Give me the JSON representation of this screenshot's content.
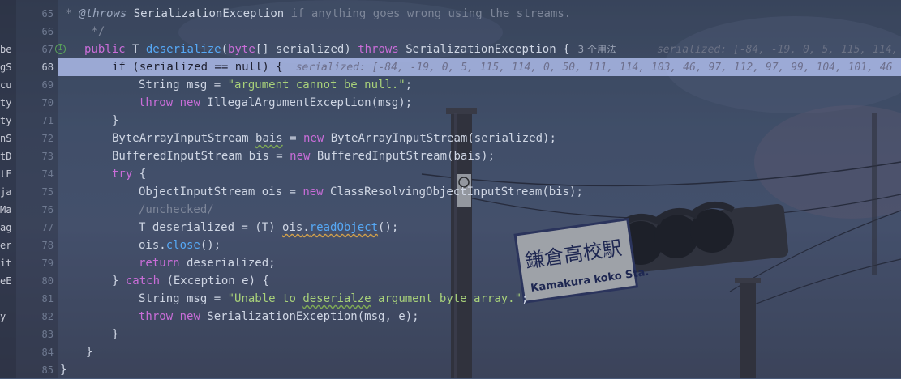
{
  "side_items": [
    "be",
    "gS",
    "cu",
    "ty",
    "ty",
    "nS",
    "tD",
    "tF",
    "ja",
    "Ma",
    "ag",
    "er",
    "it",
    "eE",
    "",
    "y"
  ],
  "line_numbers": [
    "65",
    "66",
    "67",
    "68",
    "69",
    "70",
    "71",
    "72",
    "73",
    "74",
    "75",
    "76",
    "77",
    "78",
    "79",
    "80",
    "81",
    "82",
    "83",
    "84",
    "85"
  ],
  "current_line": "68",
  "override_icon_label": "I",
  "sign_text": {
    "jp": "鎌倉高校駅",
    "en": "Kamakura koko Sta."
  },
  "code": {
    "l65": {
      "star": " * ",
      "tag": "@throws",
      "cls": " SerializationException",
      "rest": " if anything goes wrong using the streams."
    },
    "l66": {
      "text": " */"
    },
    "l67": {
      "kw1": "public",
      "t": " T ",
      "fn": "deserialize",
      "p1": "(",
      "kw2": "byte",
      "p2": "[] ",
      "param": "serialized",
      "p3": ") ",
      "kw3": "throws",
      "ex": " SerializationException",
      "p4": " {",
      "usage": "3 个用法",
      "hint": "serialized: [-84, -19, 0, 5, 115, 114, 0"
    },
    "l68": {
      "kw": "if",
      "code": " (serialized == null) {",
      "hint": "serialized: [-84, -19, 0, 5, 115, 114, 0, 50, 111, 114, 103, 46, 97, 112, 97, 99, 104, 101, 46"
    },
    "l69": {
      "type": "String",
      "code": " msg = ",
      "str": "\"argument cannot be null.\"",
      "end": ";"
    },
    "l70": {
      "kw": "throw",
      "kw2": " new",
      "code": " IllegalArgumentException(msg);"
    },
    "l71": {
      "text": "}"
    },
    "l72": {
      "type": "ByteArrayInputStream",
      "sp": " ",
      "var": "bais",
      "eq": " = ",
      "kw": "new",
      "rest": " ByteArrayInputStream(serialized);"
    },
    "l73": {
      "type": "BufferedInputStream",
      "rest": " bis = ",
      "kw": "new",
      "rest2": " BufferedInputStream(bais);"
    },
    "l74": {
      "kw": "try",
      "rest": " {"
    },
    "l75": {
      "type": "ObjectInputStream",
      "rest": " ois = ",
      "kw": "new",
      "rest2": " ClassResolvingObjectInputStream(bis);"
    },
    "l76": {
      "text": "/unchecked/"
    },
    "l77": {
      "a": "T deserialized = (T) ",
      "obj": "ois",
      "dot": ".",
      "meth": "readObject",
      "end": "();"
    },
    "l78": {
      "a": "ois.",
      "meth": "close",
      "end": "();"
    },
    "l79": {
      "kw": "return",
      "rest": " deserialized;"
    },
    "l80": {
      "a": "} ",
      "kw": "catch",
      "rest": " (Exception e) {"
    },
    "l81": {
      "type": "String",
      "a": " msg = ",
      "s1": "\"Unable to ",
      "s2": "deserialze",
      "s3": " argument byte array.\"",
      "end": ";"
    },
    "l82": {
      "kw": "throw",
      "kw2": " new",
      "rest": " SerializationException(msg, e);"
    },
    "l83": {
      "text": "}"
    },
    "l84": {
      "text": "}"
    },
    "l85": {
      "text": "}"
    }
  },
  "colors": {
    "highlight": "#b0beee",
    "keyword": "#cc7832",
    "string": "#a8d17a"
  }
}
